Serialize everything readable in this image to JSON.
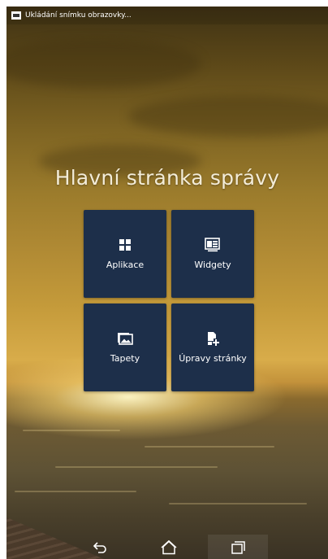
{
  "status_bar": {
    "notification_icon": "screenshot-icon",
    "text": "Ukládání snímku obrazovky..."
  },
  "title": "Hlavní stránka správy",
  "tiles": [
    {
      "label": "Aplikace",
      "icon": "grid-icon"
    },
    {
      "label": "Widgety",
      "icon": "widget-icon"
    },
    {
      "label": "Tapety",
      "icon": "wallpaper-icon"
    },
    {
      "label": "Úpravy stránky",
      "icon": "edit-page-icon"
    }
  ],
  "nav_bar": {
    "back": "back-icon",
    "home": "home-icon",
    "recent": "recent-apps-icon"
  },
  "colors": {
    "tile_background": "#1d2f4a",
    "title_text": "#f3ecd8",
    "status_text": "#ffffff"
  }
}
